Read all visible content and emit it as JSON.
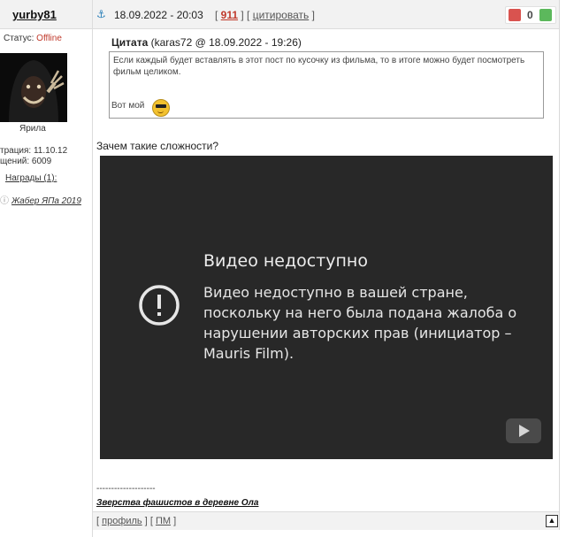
{
  "left": {
    "username": "yurby81",
    "status_label": "Статус:",
    "status_value": "Offline",
    "avatar_name": "Ярила",
    "registration": "трация: 11.10.12",
    "messages": "щений: 6009",
    "awards_label": "Награды (1):",
    "award_item": "Жабер ЯПа 2019"
  },
  "header": {
    "datetime": "18.09.2022 - 20:03",
    "post_number": "911",
    "quote_link": "цитировать",
    "vote_count": "0"
  },
  "quote": {
    "title": "Цитата",
    "source": "(karas72 @ 18.09.2022 - 19:26)",
    "text": "Если каждый будет вставлять в этот пост по кусочку из фильма, то в итоге можно будет посмотреть фильм целиком.",
    "footer": "Вот мой"
  },
  "message": "Зачем такие сложности?",
  "video": {
    "title": "Видео недоступно",
    "text": "Видео недоступно в вашей стране, поскольку на него была подана жалоба о нарушении авторских прав (инициатор – Mauris Film)."
  },
  "signature": {
    "line": "--------------------",
    "link": "Зверства фашистов в деревне Ола"
  },
  "footer": {
    "profile": "профиль",
    "pm": "ПМ"
  },
  "colors": {
    "offline": "#c0392b",
    "vote_down": "#d9534f",
    "vote_up": "#5cb85c",
    "video_bg": "#282828"
  }
}
